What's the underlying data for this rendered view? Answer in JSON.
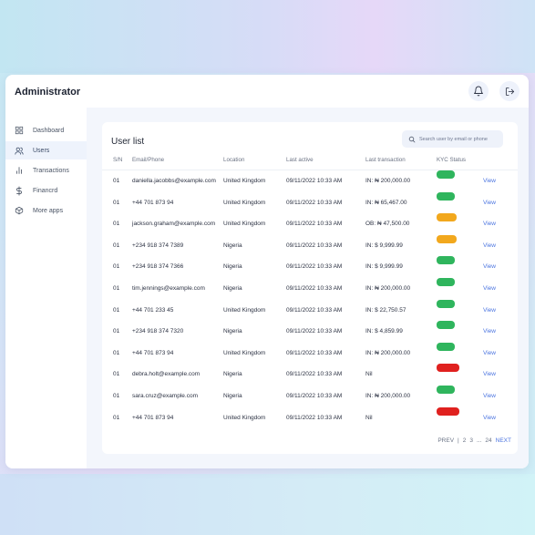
{
  "app": {
    "title": "Administrator"
  },
  "sidebar": {
    "items": [
      {
        "label": "Dashboard",
        "icon": "grid-icon",
        "active": false
      },
      {
        "label": "Users",
        "icon": "users-icon",
        "active": true
      },
      {
        "label": "Transactions",
        "icon": "bar-chart-icon",
        "active": false
      },
      {
        "label": "Financrd",
        "icon": "dollar-icon",
        "active": false
      },
      {
        "label": "More apps",
        "icon": "box-icon",
        "active": false
      }
    ]
  },
  "main": {
    "title": "User list",
    "search": {
      "placeholder": "Search user by email or phone"
    },
    "columns": [
      "S/N",
      "Email/Phone",
      "Location",
      "Last active",
      "Last transaction",
      "KYC Status"
    ],
    "rows": [
      {
        "sn": "01",
        "contact": "daniella.jacobbs@example.com",
        "location": "United Kingdom",
        "active": "09/11/2022  10:33 AM",
        "tx": "IN: ₦ 200,000.00",
        "kyc": "Verified",
        "action": "View"
      },
      {
        "sn": "01",
        "contact": "+44 701 873 94",
        "location": "United Kingdom",
        "active": "09/11/2022  10:33 AM",
        "tx": "IN: ₦ 65,467.00",
        "kyc": "Verified",
        "action": "View"
      },
      {
        "sn": "01",
        "contact": "jackson.graham@example.com",
        "location": "United Kingdom",
        "active": "09/11/2022  10:33 AM",
        "tx": "OB: ₦ 47,500.00",
        "kyc": "Pending",
        "action": "View"
      },
      {
        "sn": "01",
        "contact": "+234 918 374 7389",
        "location": "Nigeria",
        "active": "09/11/2022  10:33 AM",
        "tx": "IN: $ 9,999.99",
        "kyc": "Pending",
        "action": "View"
      },
      {
        "sn": "01",
        "contact": "+234 918 374 7366",
        "location": "Nigeria",
        "active": "09/11/2022  10:33 AM",
        "tx": "IN: $ 9,999.99",
        "kyc": "Verified",
        "action": "View"
      },
      {
        "sn": "01",
        "contact": "tim.jennings@example.com",
        "location": "Nigeria",
        "active": "09/11/2022  10:33 AM",
        "tx": "IN: ₦ 200,000.00",
        "kyc": "Verified",
        "action": "View"
      },
      {
        "sn": "01",
        "contact": "+44 701 233 45",
        "location": "United Kingdom",
        "active": "09/11/2022  10:33 AM",
        "tx": "IN: $ 22,750.57",
        "kyc": "Verified",
        "action": "View"
      },
      {
        "sn": "01",
        "contact": "+234 918 374 7320",
        "location": "Nigeria",
        "active": "09/11/2022  10:33 AM",
        "tx": "IN: $ 4,859.99",
        "kyc": "Verified",
        "action": "View"
      },
      {
        "sn": "01",
        "contact": "+44 701 873 94",
        "location": "United Kingdom",
        "active": "09/11/2022  10:33 AM",
        "tx": "IN: ₦ 200,000.00",
        "kyc": "Verified",
        "action": "View"
      },
      {
        "sn": "01",
        "contact": "debra.holt@example.com",
        "location": "Nigeria",
        "active": "09/11/2022  10:33 AM",
        "tx": "Nil",
        "kyc": "Unverified",
        "action": "View"
      },
      {
        "sn": "01",
        "contact": "sara.cruz@example.com",
        "location": "Nigeria",
        "active": "09/11/2022  10:33 AM",
        "tx": "IN: ₦ 200,000.00",
        "kyc": "Verified",
        "action": "View"
      },
      {
        "sn": "01",
        "contact": "+44 701 873 94",
        "location": "United Kingdom",
        "active": "09/11/2022  10:33 AM",
        "tx": "Nil",
        "kyc": "Unverified",
        "action": "View"
      }
    ],
    "pagination": {
      "prev": "PREV",
      "sep": "|",
      "pages": [
        "2",
        "3",
        "...",
        "24"
      ],
      "next": "NEXT"
    }
  },
  "colors": {
    "verified": "#2fb55d",
    "pending": "#f2a81d",
    "unverified": "#e0211f",
    "accent": "#4b74e0"
  }
}
